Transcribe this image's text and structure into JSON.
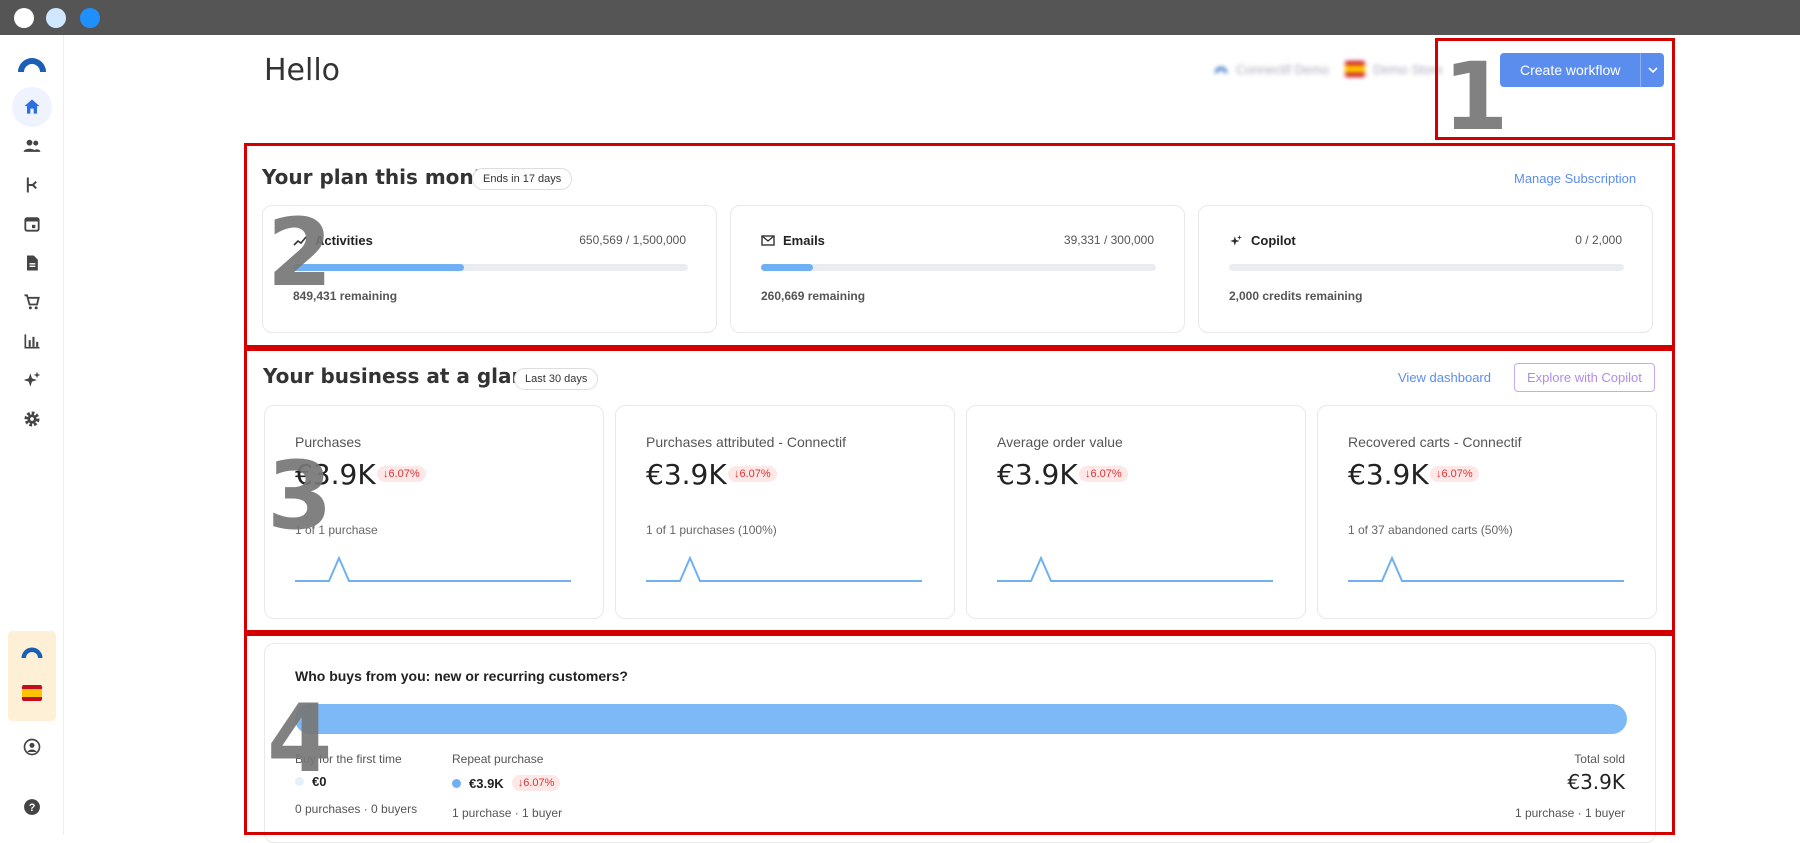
{
  "window": {
    "controls": [
      "close",
      "minimize",
      "maximize"
    ]
  },
  "sidebar": {
    "items": [
      {
        "name": "home",
        "icon": "home-icon",
        "active": true
      },
      {
        "name": "contacts",
        "icon": "users-icon"
      },
      {
        "name": "workflows",
        "icon": "workflow-icon"
      },
      {
        "name": "calendar",
        "icon": "calendar-icon"
      },
      {
        "name": "documents",
        "icon": "document-icon"
      },
      {
        "name": "shop",
        "icon": "cart-icon"
      },
      {
        "name": "analytics",
        "icon": "bar-chart-icon"
      },
      {
        "name": "copilot",
        "icon": "sparkle-icon"
      },
      {
        "name": "settings",
        "icon": "gear-icon"
      }
    ],
    "bottom": [
      {
        "name": "account",
        "icon": "user-circle-icon"
      },
      {
        "name": "help",
        "icon": "help-icon"
      }
    ]
  },
  "header": {
    "greeting": "Hello",
    "account_name": "Connectif Demo",
    "store_name": "Demo Store",
    "create_button": "Create workflow"
  },
  "plan": {
    "title": "Your plan this month",
    "ends_pill": "Ends in 17 days",
    "manage_link": "Manage Subscription",
    "cards": [
      {
        "label": "Activities",
        "icon": "trend-icon",
        "count": "650,569 / 1,500,000",
        "progress": 0.434,
        "remaining": "849,431 remaining"
      },
      {
        "label": "Emails",
        "icon": "mail-icon",
        "count": "39,331 / 300,000",
        "progress": 0.131,
        "remaining": "260,669 remaining"
      },
      {
        "label": "Copilot",
        "icon": "sparkle-icon",
        "count": "0 / 2,000",
        "progress": 0,
        "remaining": "2,000 credits remaining"
      }
    ]
  },
  "business": {
    "title": "Your business at a glance",
    "period_pill": "Last 30 days",
    "dashboard_link": "View dashboard",
    "copilot_button": "Explore with Copilot",
    "kpis": [
      {
        "title": "Purchases",
        "value": "€3.9K",
        "delta": "6.07%",
        "sub": "1 of 1 purchase"
      },
      {
        "title": "Purchases attributed - Connectif",
        "value": "€3.9K",
        "delta": "6.07%",
        "sub": "1 of 1 purchases (100%)"
      },
      {
        "title": "Average order value",
        "value": "€3.9K",
        "delta": "6.07%",
        "sub": ""
      },
      {
        "title": "Recovered carts - Connectif",
        "value": "€3.9K",
        "delta": "6.07%",
        "sub": "1 of 37 abandoned carts (50%)"
      }
    ]
  },
  "customers": {
    "question": "Who buys from you: new or recurring customers?",
    "first_label": "Buy for the first time",
    "first_value": "€0",
    "first_sub": "0 purchases · 0 buyers",
    "repeat_label": "Repeat purchase",
    "repeat_value": "€3.9K",
    "repeat_delta": "6.07%",
    "repeat_sub": "1 purchase · 1 buyer",
    "total_label": "Total sold",
    "total_value": "€3.9K",
    "total_sub": "1 purchase · 1 buyer",
    "repeat_share": 1.0
  },
  "annotations": [
    "1",
    "2",
    "3",
    "4"
  ],
  "colors": {
    "accent": "#5b8def",
    "bar": "#7db8f7",
    "annotation_border": "#d40000",
    "negative": "#d33333"
  }
}
